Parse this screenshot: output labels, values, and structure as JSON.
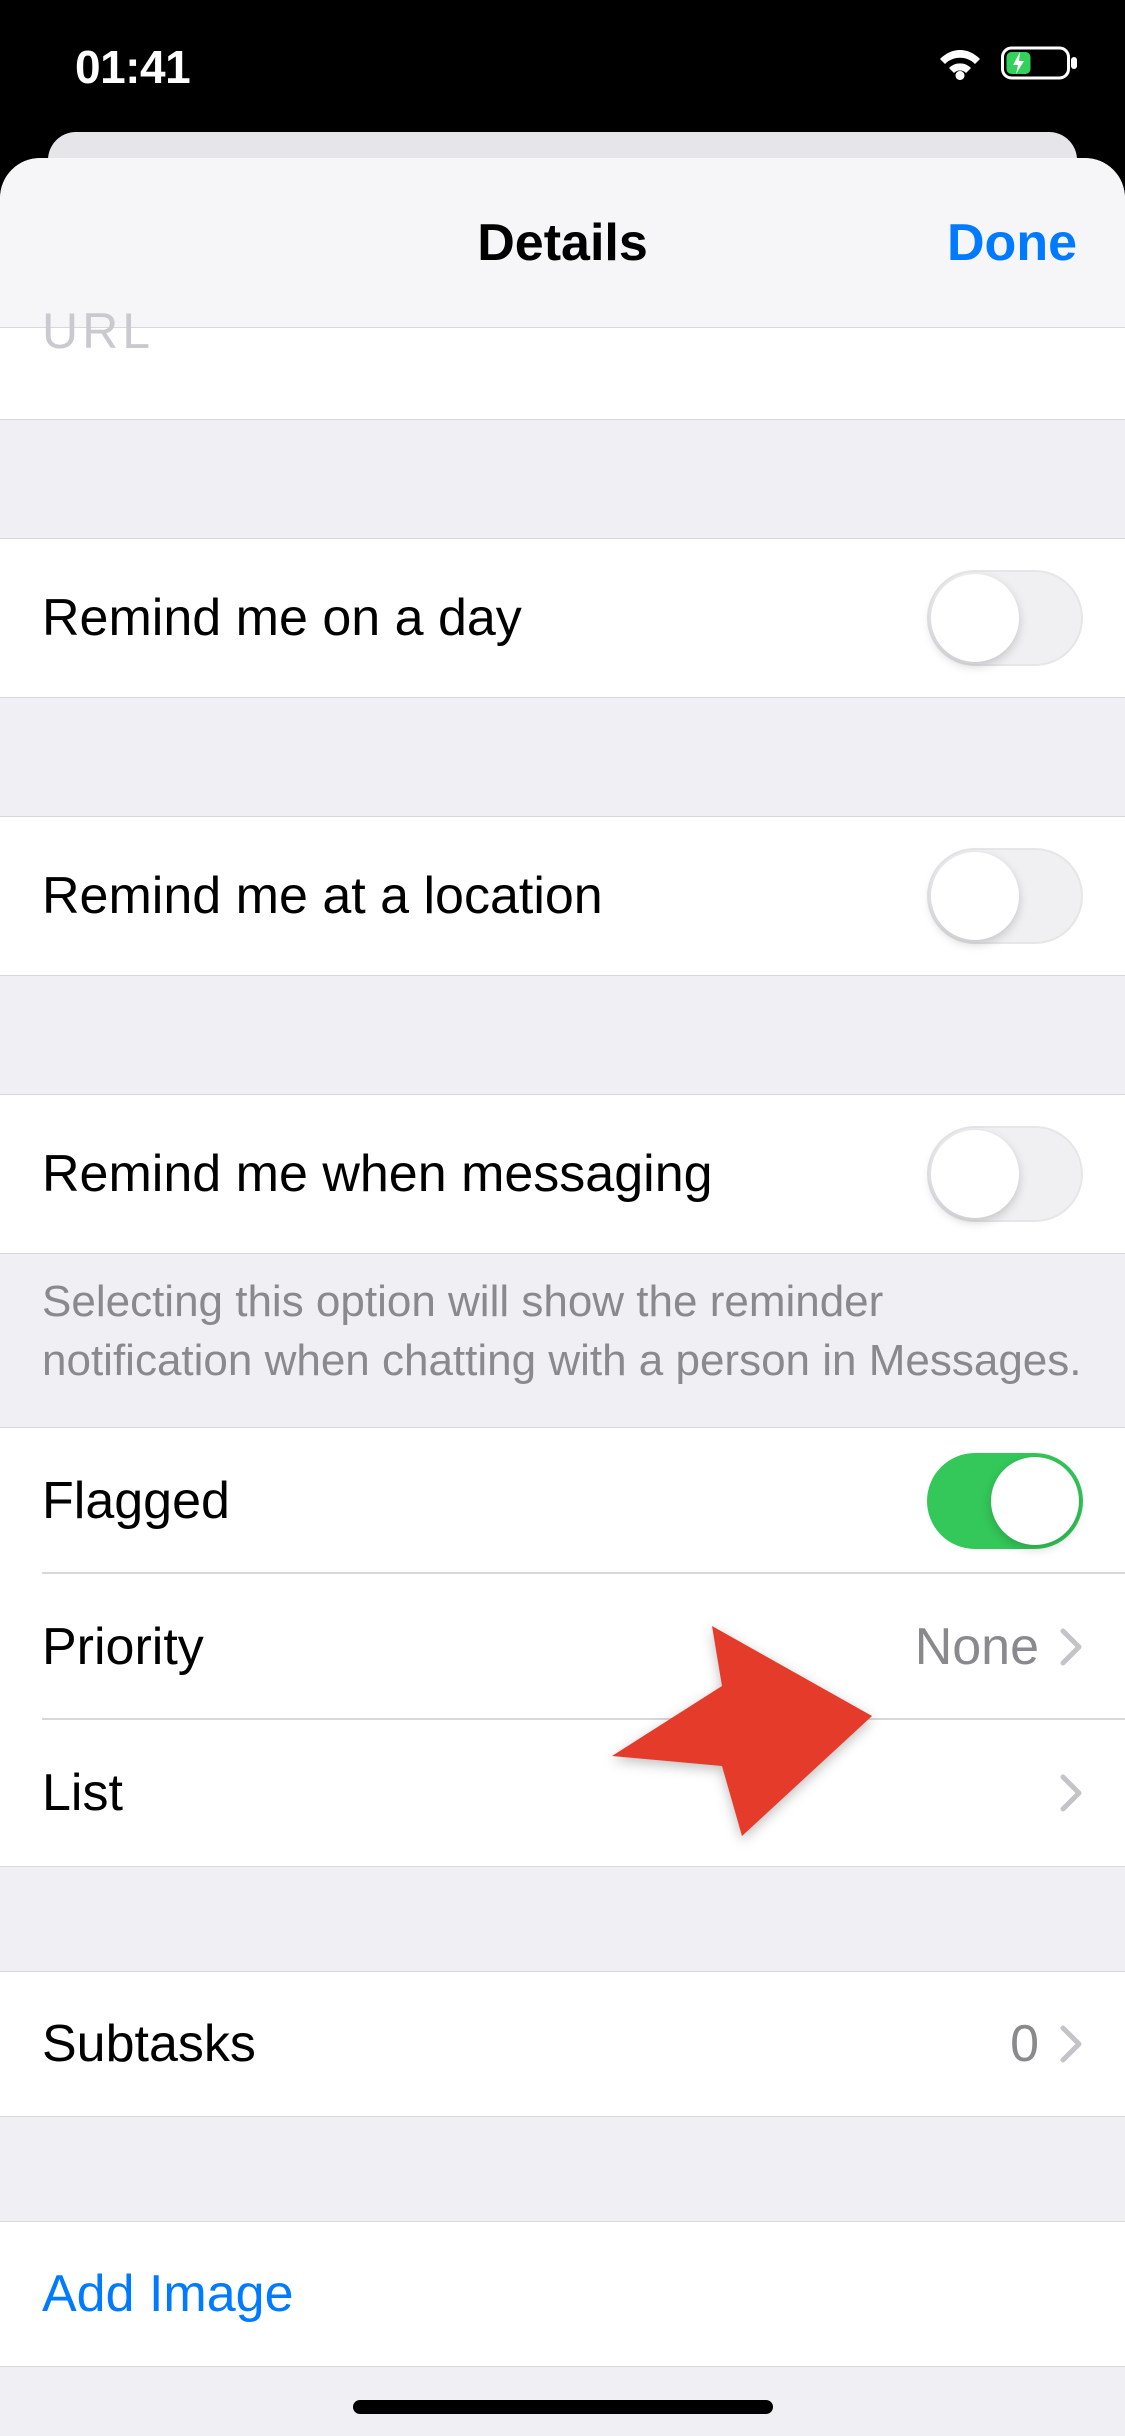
{
  "status": {
    "time": "01:41"
  },
  "header": {
    "title": "Details",
    "done": "Done"
  },
  "urlRow": {
    "placeholder": "URL"
  },
  "remindDay": {
    "label": "Remind me on a day"
  },
  "remindLoc": {
    "label": "Remind me at a location"
  },
  "remindMsg": {
    "label": "Remind me when messaging",
    "note": "Selecting this option will show the reminder notification when chatting with a person in Messages."
  },
  "flagged": {
    "label": "Flagged"
  },
  "priority": {
    "label": "Priority",
    "value": "None"
  },
  "list": {
    "label": "List"
  },
  "subtasks": {
    "label": "Subtasks",
    "count": "0"
  },
  "addImage": {
    "label": "Add Image"
  }
}
